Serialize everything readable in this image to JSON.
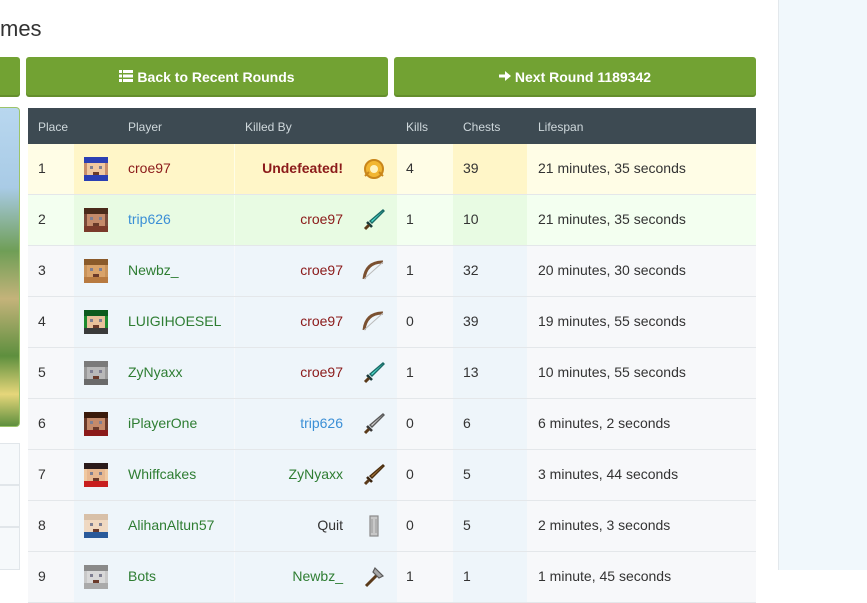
{
  "page": {
    "title_partial": "mes"
  },
  "buttons": {
    "back": {
      "label": "Back to Recent Rounds"
    },
    "next": {
      "label": "Next Round 1189342"
    }
  },
  "table": {
    "headers": {
      "place": "Place",
      "player": "Player",
      "killed_by": "Killed By",
      "kills": "Kills",
      "chests": "Chests",
      "lifespan": "Lifespan"
    },
    "rows": [
      {
        "place": "1",
        "player": "croe97",
        "killed_by": "Undefeated!",
        "weapon": "trophy-icon",
        "kills": "4",
        "chests": "39",
        "lifespan": "21 minutes, 35 seconds"
      },
      {
        "place": "2",
        "player": "trip626",
        "killed_by": "croe97",
        "weapon": "diamond-sword-icon",
        "kills": "1",
        "chests": "10",
        "lifespan": "21 minutes, 35 seconds"
      },
      {
        "place": "3",
        "player": "Newbz_",
        "killed_by": "croe97",
        "weapon": "bow-icon",
        "kills": "1",
        "chests": "32",
        "lifespan": "20 minutes, 30 seconds"
      },
      {
        "place": "4",
        "player": "LUIGIHOESEL",
        "killed_by": "croe97",
        "weapon": "bow-icon",
        "kills": "0",
        "chests": "39",
        "lifespan": "19 minutes, 55 seconds"
      },
      {
        "place": "5",
        "player": "ZyNyaxx",
        "killed_by": "croe97",
        "weapon": "diamond-sword-icon",
        "kills": "1",
        "chests": "13",
        "lifespan": "10 minutes, 55 seconds"
      },
      {
        "place": "6",
        "player": "iPlayerOne",
        "killed_by": "trip626",
        "weapon": "iron-sword-icon",
        "kills": "0",
        "chests": "6",
        "lifespan": "6 minutes, 2 seconds"
      },
      {
        "place": "7",
        "player": "Whiffcakes",
        "killed_by": "ZyNyaxx",
        "weapon": "wooden-sword-icon",
        "kills": "0",
        "chests": "5",
        "lifespan": "3 minutes, 44 seconds"
      },
      {
        "place": "8",
        "player": "AlihanAltun57",
        "killed_by": "Quit",
        "weapon": "quit-icon",
        "kills": "0",
        "chests": "5",
        "lifespan": "2 minutes, 3 seconds"
      },
      {
        "place": "9",
        "player": "Bots",
        "killed_by": "Newbz_",
        "weapon": "iron-axe-icon",
        "kills": "1",
        "chests": "1",
        "lifespan": "1 minute, 45 seconds"
      }
    ]
  },
  "colors": {
    "button_green": "#72a233",
    "header_dark": "#3d4a52",
    "link_red": "#8b1a1a",
    "link_blue": "#3b8fd6",
    "link_green": "#2e7d32"
  }
}
